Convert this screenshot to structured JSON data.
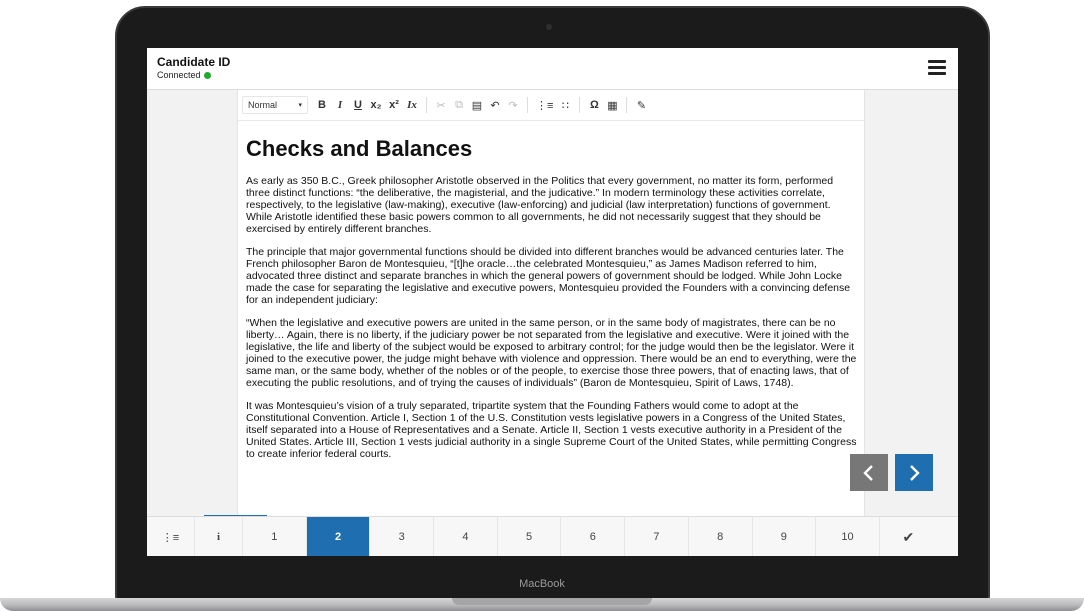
{
  "device": {
    "brand": "MacBook"
  },
  "header": {
    "candidate_label": "Candidate ID",
    "status": "Connected",
    "status_color": "#1faa2f"
  },
  "toolbar": {
    "style_select": "Normal",
    "buttons": [
      "B",
      "I",
      "U",
      "x₂",
      "x²",
      "Ix"
    ],
    "icons": [
      "cut-icon",
      "copy-icon",
      "paste-icon",
      "undo-icon",
      "redo-icon",
      "numbered-list-icon",
      "bulleted-list-icon",
      "omega-icon",
      "table-icon",
      "pencil-icon"
    ]
  },
  "document": {
    "title": "Checks and Balances",
    "paragraphs": [
      "As early as 350 B.C., Greek philosopher Aristotle observed in the Politics that every government, no matter its form, performed three distinct functions: “the deliberative, the magisterial, and the judicative.” In modern terminology these activities correlate, respectively, to the legislative (law-making), executive (law-enforcing) and judicial (law interpretation) functions of government. While Aristotle identified these basic powers common to all governments, he did not necessarily suggest that they should be exercised by entirely different branches.",
      "The principle that major governmental functions should be divided into different branches would be advanced centuries later. The French philosopher Baron de Montesquieu, “[t]he oracle…the celebrated Montesquieu,” as James Madison referred to him, advocated three distinct and separate branches in which the general powers of government should be lodged. While John Locke made the case for separating the legislative and executive powers, Montesquieu provided the Founders with a convincing defense for an independent judiciary:",
      "“When the legislative and executive powers are united in the same person, or in the same body of magistrates, there can be no liberty… Again, there is no liberty, if the judiciary power be not separated from the legislative and executive. Were it joined with the legislative, the life and liberty of the subject would be exposed to arbitrary control; for the judge would then be the legislator. Were it joined to the executive power, the judge might behave with violence and oppression. There would be an end to everything, were the same man, or the same body, whether of the nobles or of the people, to exercise those three powers, that of enacting laws, that of executing the public resolutions, and of trying the causes of individuals” (Baron de Montesquieu, Spirit of Laws, 1748).",
      "It was Montesquieu’s vision of a truly separated, tripartite system that the Founding Fathers would come to adopt at the Constitutional Convention. Article I, Section 1 of the U.S. Constitution vests legislative powers in a Congress of the United States, itself separated into a House of Representatives and a Senate. Article II, Section 1 vests executive authority in a President of the United States. Article III, Section 1 vests judicial authority in a single Supreme Court of the United States, while permitting Congress to create inferior federal courts."
    ]
  },
  "footer": {
    "pages": [
      "1",
      "2",
      "3",
      "4",
      "5",
      "6",
      "7",
      "8",
      "9",
      "10"
    ],
    "active_page": "2",
    "info_label": "i",
    "accent_color": "#1f6fb0"
  }
}
